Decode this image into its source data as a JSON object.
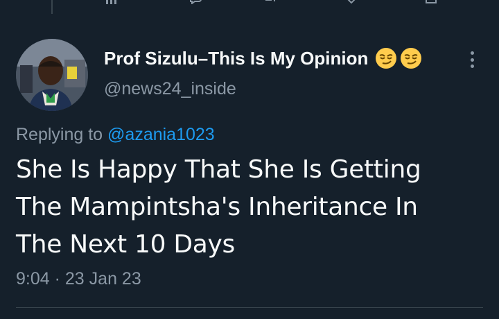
{
  "tweet": {
    "author": {
      "display_name": "Prof Sizulu–This Is My Opinion",
      "handle": "@news24_inside"
    },
    "emoji_icons": [
      "smirking-face-icon",
      "smirking-face-icon"
    ],
    "reply": {
      "prefix": "Replying to",
      "mention": "@azania1023"
    },
    "text_lines": [
      "She Is Happy That She Is Getting",
      "The Mampintsha's Inheritance In",
      "The Next 10 Days"
    ],
    "time": "9:04",
    "separator": "·",
    "date": "23 Jan 23"
  },
  "colors": {
    "background": "#15202b",
    "text": "#f7f9f9",
    "secondary": "#8b98a5",
    "link": "#1d9bf0",
    "divider": "#38444d"
  }
}
